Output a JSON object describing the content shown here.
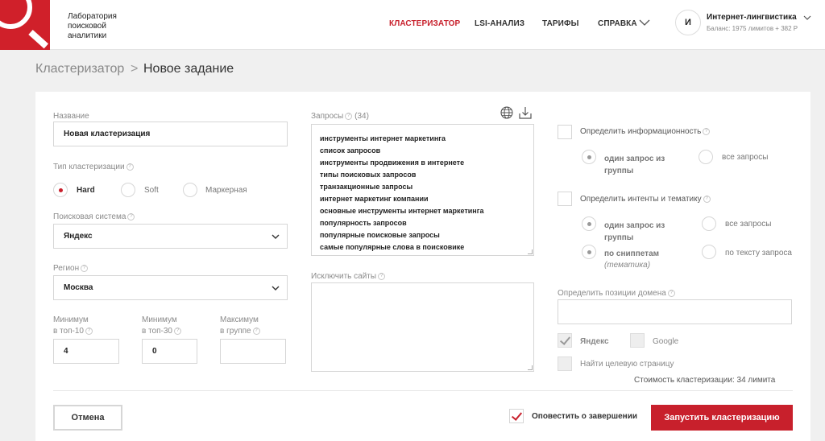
{
  "brand": {
    "line1": "Лаборатория",
    "line2": "поисковой",
    "line3": "аналитики"
  },
  "nav": {
    "clusterizer": "КЛАСТЕРИЗАТОР",
    "lsi": "LSI-АНАЛИЗ",
    "tariffs": "ТАРИФЫ",
    "help": "СПРАВКА"
  },
  "user": {
    "initial": "И",
    "name": "Интернет-лингвистика",
    "balance": "Баланс: 1975 лимитов + 382 Р"
  },
  "breadcrumb": {
    "parent": "Кластеризатор",
    "separator": ">",
    "current": "Новое задание"
  },
  "form": {
    "name_label": "Название",
    "name_value": "Новая кластеризация",
    "type_label": "Тип кластеризации",
    "type_options": [
      "Hard",
      "Soft",
      "Маркерная"
    ],
    "engine_label": "Поисковая система",
    "engine_value": "Яндекс",
    "region_label": "Регион",
    "region_value": "Москва",
    "min_top10": {
      "l1": "Минимум",
      "l2": "в топ-10",
      "value": "4"
    },
    "min_top30": {
      "l1": "Минимум",
      "l2": "в топ-30",
      "value": "0"
    },
    "max_group": {
      "l1": "Максимум",
      "l2": "в группе",
      "value": ""
    }
  },
  "queries": {
    "label": "Запросы",
    "count": "(34)",
    "items": [
      "инструменты интернет маркетинга",
      "список запросов",
      "инструменты продвижения в интернете",
      "типы поисковых запросов",
      "транзакционные запросы",
      "интернет маркетинг компании",
      "основные инструменты интернет маркетинга",
      "популярность запросов",
      "популярные поисковые запросы",
      "самые популярные слова в поисковике"
    ],
    "exclude_label": "Исключить сайты"
  },
  "options": {
    "info_label": "Определить информационность",
    "info_opt1_l1": "один запрос из",
    "info_opt1_l2": "группы",
    "info_opt2": "все запросы",
    "intent_label": "Определить интенты и тематику",
    "intent_opt1_l1": "один запрос из",
    "intent_opt1_l2": "группы",
    "intent_opt2": "все запросы",
    "intent_opt3_l1": "по сниппетам",
    "intent_opt3_l2": "(тематика)",
    "intent_opt4": "по тексту запроса",
    "domain_label": "Определить позиции домена",
    "yandex": "Яндекс",
    "google": "Google",
    "target_page": "Найти целевую страницу",
    "cost": "Стоимость кластеризации: 34 лимита"
  },
  "footer": {
    "cancel": "Отмена",
    "notify": "Оповестить о завершении",
    "run": "Запустить кластеризацию"
  }
}
